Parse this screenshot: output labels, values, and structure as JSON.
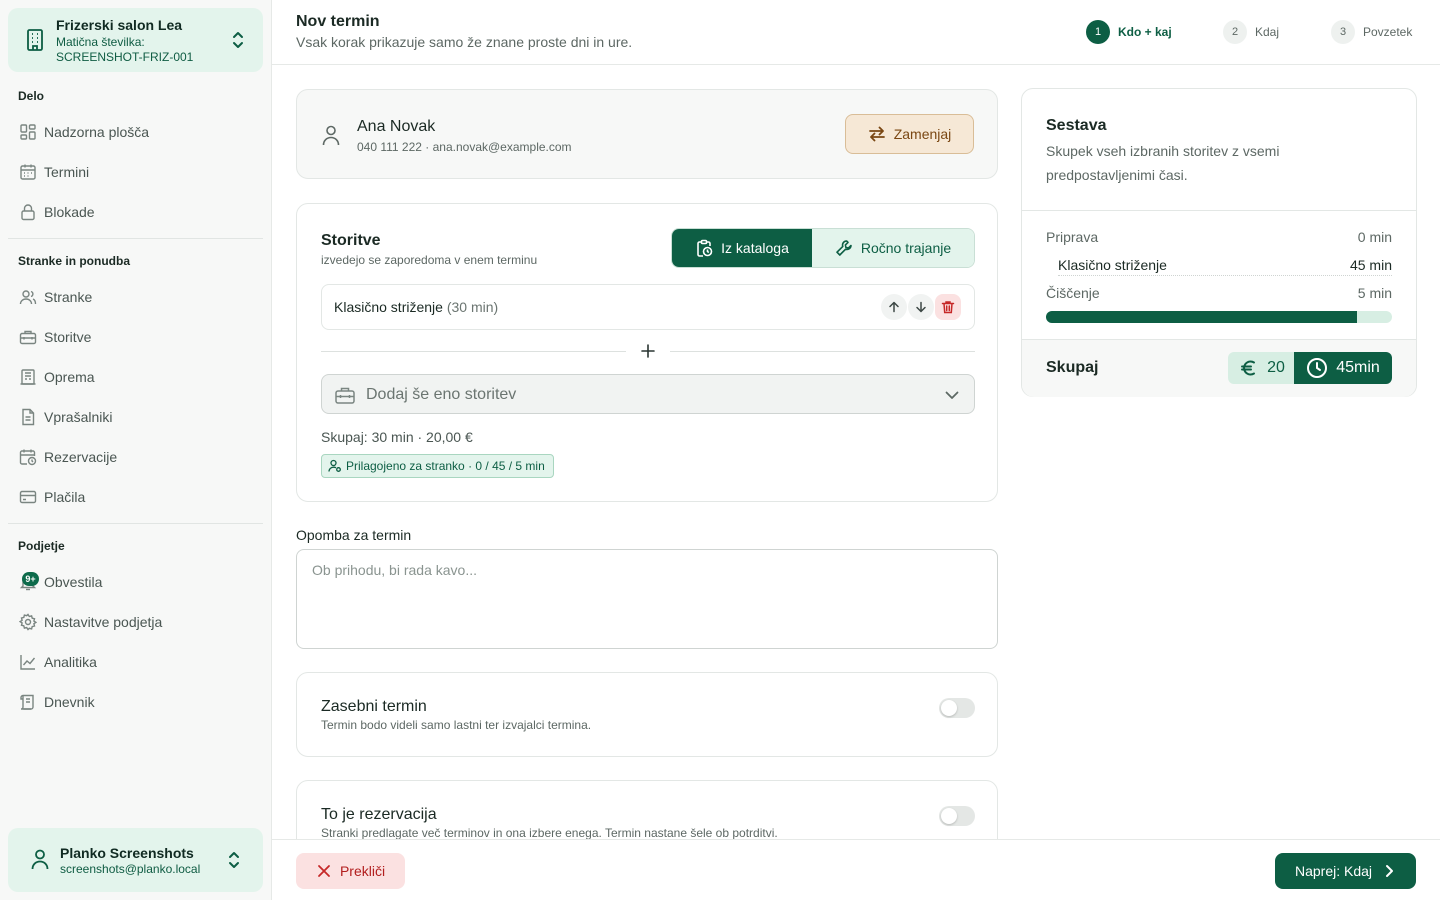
{
  "colors": {
    "brand": "#0d5e44",
    "brand_light": "#e3f4ec",
    "danger": "#b21e1e",
    "warning_bg": "#f6e8d6"
  },
  "org": {
    "name": "Frizerski salon Lea",
    "id_label": "Matična številka:",
    "id_value": "SCREENSHOT-FRIZ-001",
    "icon": "building-icon"
  },
  "sidebar": {
    "sections": [
      {
        "title": "Delo"
      },
      {
        "title": "Stranke in ponudba"
      },
      {
        "title": "Podjetje"
      }
    ],
    "items": [
      {
        "label": "Nadzorna plošča",
        "icon": "dashboard-icon"
      },
      {
        "label": "Termini",
        "icon": "calendar-icon"
      },
      {
        "label": "Blokade",
        "icon": "lock-icon"
      },
      {
        "label": "Stranke",
        "icon": "users-icon"
      },
      {
        "label": "Storitve",
        "icon": "toolbox-icon"
      },
      {
        "label": "Oprema",
        "icon": "equipment-icon"
      },
      {
        "label": "Vprašalniki",
        "icon": "document-icon"
      },
      {
        "label": "Rezervacije",
        "icon": "calendar-clock-icon"
      },
      {
        "label": "Plačila",
        "icon": "credit-card-icon"
      },
      {
        "label": "Obvestila",
        "icon": "bell-icon",
        "badge": "9+"
      },
      {
        "label": "Nastavitve podjetja",
        "icon": "gear-icon"
      },
      {
        "label": "Analitika",
        "icon": "chart-line-icon"
      },
      {
        "label": "Dnevnik",
        "icon": "scroll-icon"
      }
    ]
  },
  "user": {
    "name": "Planko Screenshots",
    "email": "screenshots@planko.local"
  },
  "header": {
    "title": "Nov termin",
    "subtitle": "Vsak korak prikazuje samo že znane proste dni in ure.",
    "steps": [
      {
        "num": "1",
        "label": "Kdo + kaj",
        "active": true
      },
      {
        "num": "2",
        "label": "Kdaj",
        "active": false
      },
      {
        "num": "3",
        "label": "Povzetek",
        "active": false
      }
    ]
  },
  "client": {
    "name": "Ana Novak",
    "info": "040 111 222 · ana.novak@example.com",
    "swap_label": "Zamenjaj"
  },
  "services": {
    "title": "Storitve",
    "subtitle": "izvedejo se zaporedoma v enem terminu",
    "mode_catalog": "Iz kataloga",
    "mode_manual": "Ročno trajanje",
    "items": [
      {
        "name": "Klasično striženje",
        "duration": "(30 min)"
      }
    ],
    "add_placeholder": "Dodaj še eno storitev",
    "total": "Skupaj: 30 min · 20,00 €",
    "custom_badge": "Prilagojeno za stranko · 0 / 45 / 5 min"
  },
  "note": {
    "label": "Opomba za termin",
    "placeholder": "Ob prihodu, bi rada kavo...",
    "value": ""
  },
  "private": {
    "title": "Zasebni termin",
    "desc": "Termin bodo videli samo lastni ter izvajalci termina.",
    "on": false
  },
  "reservation": {
    "title": "To je rezervacija",
    "desc": "Stranki predlagate več terminov in ona izbere enega. Termin nastane šele ob potrditvi.",
    "on": false
  },
  "footer": {
    "cancel_label": "Prekliči",
    "next_label": "Naprej: Kdaj"
  },
  "summary": {
    "title": "Sestava",
    "desc": "Skupek vseh izbranih storitev z vsemi predpostavljenimi časi.",
    "rows": [
      {
        "label": "Priprava",
        "value": "0 min"
      },
      {
        "label": "Klasično striženje",
        "value": "45 min"
      },
      {
        "label": "Čiščenje",
        "value": "5 min"
      }
    ],
    "progress_fraction": 0.9,
    "total_label": "Skupaj",
    "total_price": "20",
    "total_time": "45min"
  }
}
